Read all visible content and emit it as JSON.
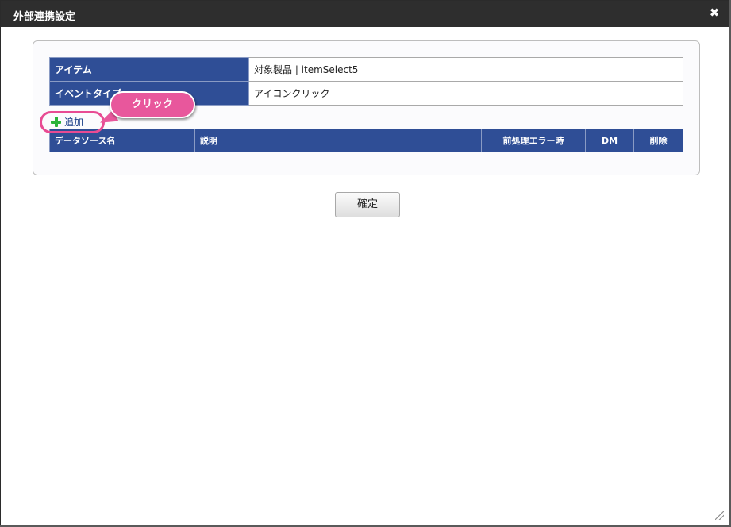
{
  "dialog": {
    "title": "外部連携設定",
    "close_glyph": "✖"
  },
  "properties": [
    {
      "label": "アイテム",
      "value": "対象製品 | itemSelect5"
    },
    {
      "label": "イベントタイプ",
      "value": "アイコンクリック"
    }
  ],
  "add_link": {
    "label": "追加",
    "icon": "plus-icon"
  },
  "callout": {
    "text": "クリック"
  },
  "grid": {
    "columns": [
      "データソース名",
      "説明",
      "前処理エラー時",
      "DM",
      "削除"
    ]
  },
  "confirm_button": {
    "label": "確定"
  },
  "colors": {
    "header_blue": "#2f4e96",
    "callout_pink": "#e8579c",
    "titlebar": "#2e2e2e"
  }
}
